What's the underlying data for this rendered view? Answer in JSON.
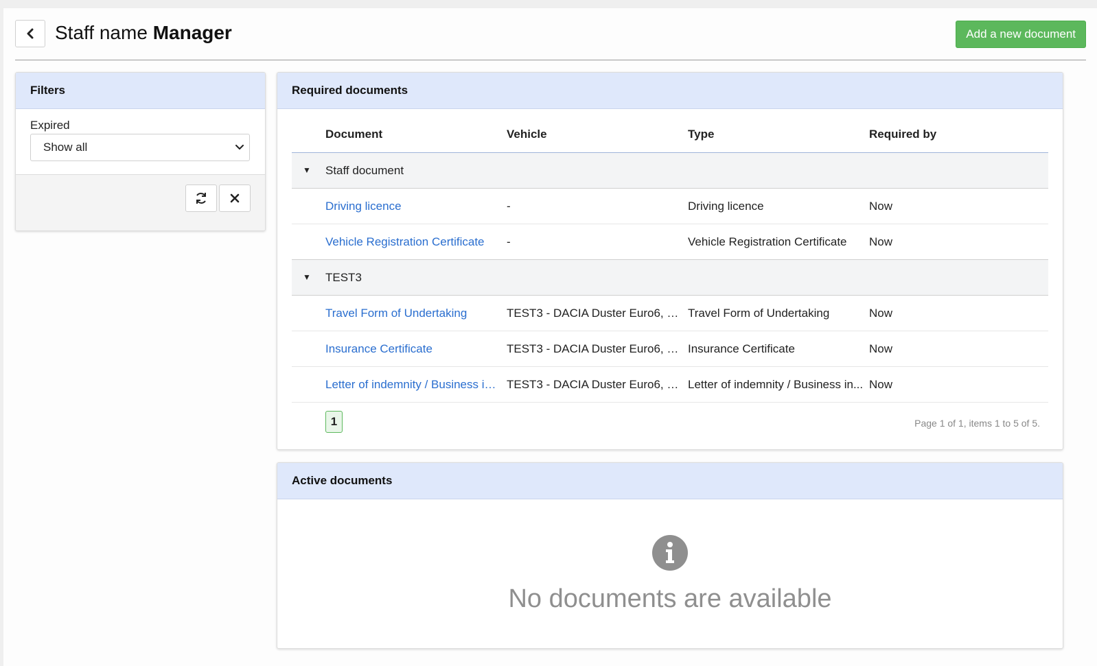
{
  "header": {
    "title_prefix": "Staff name",
    "title_name": "Manager",
    "add_button": "Add a new document",
    "back_icon": "chevron-left-icon"
  },
  "filters": {
    "title": "Filters",
    "expired_label": "Expired",
    "expired_value": "Show all",
    "refresh_icon": "refresh-icon",
    "clear_icon": "close-icon"
  },
  "required": {
    "title": "Required documents",
    "columns": [
      "Document",
      "Vehicle",
      "Type",
      "Required by"
    ],
    "groups": [
      {
        "name": "Staff document",
        "rows": [
          {
            "document": "Driving licence",
            "vehicle": "-",
            "type": "Driving licence",
            "required_by": "Now"
          },
          {
            "document": "Vehicle Registration Certificate",
            "vehicle": "-",
            "type": "Vehicle Registration Certificate",
            "required_by": "Now"
          }
        ]
      },
      {
        "name": "TEST3",
        "rows": [
          {
            "document": "Travel Form of Undertaking",
            "vehicle": "TEST3 - DACIA Duster Euro6, 2...",
            "type": "Travel Form of Undertaking",
            "required_by": "Now"
          },
          {
            "document": "Insurance Certificate",
            "vehicle": "TEST3 - DACIA Duster Euro6, 2...",
            "type": "Insurance Certificate",
            "required_by": "Now"
          },
          {
            "document": "Letter of indemnity / Business in...",
            "vehicle": "TEST3 - DACIA Duster Euro6, 2...",
            "type": "Letter of indemnity / Business in...",
            "required_by": "Now"
          }
        ]
      }
    ],
    "pager": {
      "current_page": "1",
      "info": "Page 1 of 1, items 1 to 5 of 5."
    }
  },
  "active": {
    "title": "Active documents",
    "empty_message": "No documents are available",
    "empty_icon": "info-circle-icon"
  },
  "colors": {
    "accent_green": "#5cb85c",
    "link_blue": "#2a6ecf",
    "panel_heading": "#dfe8fb"
  }
}
